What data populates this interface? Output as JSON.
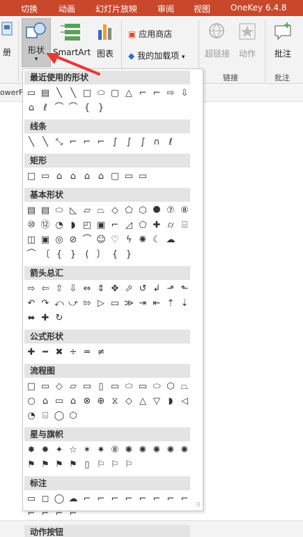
{
  "tabs": [
    "切换",
    "动画",
    "幻灯片放映",
    "审阅",
    "视图",
    "OneKey 6.4.8"
  ],
  "ribbon": {
    "left_partial_label": "册",
    "shapes_label": "形状",
    "smartart_label": "SmartArt",
    "chart_label": "图表",
    "appstore_label": "应用商店",
    "my_addins_label": "我的加载项",
    "hyperlink_label": "超链接",
    "action_label": "动作",
    "comment_label": "批注",
    "group_links": "链接",
    "group_comments": "批注"
  },
  "behind": {
    "ruler_text": "owerF"
  },
  "gallery": {
    "sections": [
      {
        "title": "最近使用的形状",
        "rows": [
          [
            "▭",
            "▤",
            "╲",
            "╲",
            "□",
            "⬭",
            "▢",
            "△",
            "⌐",
            "⌐",
            "⇨",
            "⇩"
          ],
          [
            "⌂",
            "ℓ",
            "⌒",
            "⌒",
            "{",
            "}"
          ]
        ]
      },
      {
        "title": "线条",
        "rows": [
          [
            "╲",
            "╲",
            "⤡",
            "⌐",
            "⌐",
            "⌐",
            "∫",
            "∫",
            "∫",
            "∩",
            "ℓ"
          ]
        ]
      },
      {
        "title": "矩形",
        "rows": [
          [
            "□",
            "▭",
            "⌂",
            "⌂",
            "⌂",
            "⌂",
            "▢",
            "▭",
            "▭"
          ]
        ]
      },
      {
        "title": "基本形状",
        "rows": [
          [
            "▤",
            "▤",
            "⬭",
            "◺",
            "▱",
            "⏢",
            "◇",
            "⬠",
            "⬡",
            "⯃",
            "⑦",
            "⑧"
          ],
          [
            "⑩",
            "⑫",
            "◔",
            "◗",
            "◰",
            "▣",
            "⌐",
            "◿",
            "⬠",
            "✚",
            "⌭",
            "⌸"
          ],
          [
            "◫",
            "▣",
            "◎",
            "⊘",
            "⌒",
            "☺",
            "♡",
            "ϟ",
            "✺",
            "☾",
            "☁"
          ],
          [
            "⌒",
            "〔",
            "{",
            "}",
            "(",
            "〕",
            "{",
            "}"
          ]
        ]
      },
      {
        "title": "箭头总汇",
        "rows": [
          [
            "⇨",
            "⇦",
            "⇧",
            "⇩",
            "⇔",
            "⇕",
            "✥",
            "⬀",
            "↺",
            "↲",
            "⬏",
            "⬑"
          ],
          [
            "↶",
            "↷",
            "⤺",
            "⤻",
            "⇰",
            "▷",
            "▭",
            "≫",
            "⇥",
            "⇤",
            "⇡",
            "⇣"
          ],
          [
            "⬌",
            "✚",
            "↻"
          ]
        ]
      },
      {
        "title": "公式形状",
        "rows": [
          [
            "✚",
            "━",
            "✖",
            "÷",
            "═",
            "≠"
          ]
        ]
      },
      {
        "title": "流程图",
        "rows": [
          [
            "□",
            "▭",
            "◇",
            "▱",
            "▭",
            "▯",
            "▭",
            "⬭",
            "▭",
            "⬭",
            "⬡",
            "⏢"
          ],
          [
            "○",
            "⌂",
            "▭",
            "⌂",
            "⊗",
            "⊕",
            "⧖",
            "◇",
            "△",
            "▽",
            "◗",
            "◁"
          ],
          [
            "◔",
            "⌸",
            "◯",
            "⬡"
          ]
        ]
      },
      {
        "title": "星与旗帜",
        "rows": [
          [
            "✸",
            "✹",
            "✦",
            "☆",
            "✶",
            "✷",
            "⑧",
            "✺",
            "✺",
            "✺",
            "✺",
            "✺"
          ],
          [
            "⚑",
            "⚑",
            "⚑",
            "⚑",
            "▯",
            "⚐",
            "⚐",
            "⚐"
          ]
        ]
      },
      {
        "title": "标注",
        "rows": [
          [
            "▭",
            "◻",
            "◯",
            "☁",
            "⌐",
            "⌐",
            "⌐",
            "⌐",
            "⌐",
            "⌐",
            "⌐",
            "⌐"
          ],
          [
            "⌐",
            "⌐",
            "⌐",
            "⌐"
          ]
        ]
      },
      {
        "title": "动作按钮",
        "rows": [
          [
            "◁",
            "▷",
            "⏮",
            "⏭",
            "⌂",
            "ⓘ",
            "↶",
            "▶",
            "▭",
            "?",
            "□"
          ]
        ]
      }
    ]
  }
}
